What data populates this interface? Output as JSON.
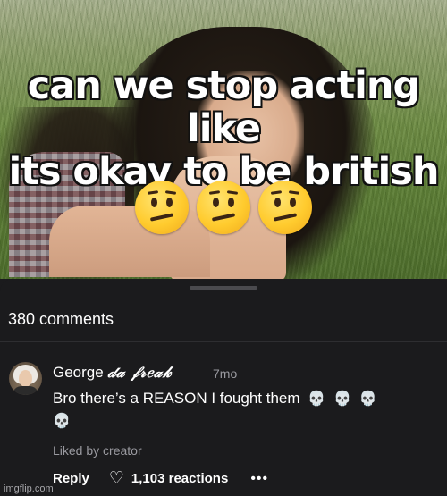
{
  "meme": {
    "caption_lines": [
      "can we stop acting like",
      "its okay to be british"
    ],
    "emojis": [
      "confused-face",
      "confused-face",
      "confused-face"
    ]
  },
  "comments": {
    "count_label": "380 comments",
    "items": [
      {
        "author": "George",
        "author_suffix": "𝒹𝒶 𝒻𝓇𝑒𝒶𝓀",
        "time": "7mo",
        "text": "Bro there’s a REASON I fought them",
        "trailing_emojis": [
          "💀",
          "💀",
          "💀",
          "💀"
        ],
        "liked_label": "Liked by creator",
        "reply_label": "Reply",
        "reactions_label": "1,103 reactions",
        "more_label": "•••"
      }
    ]
  },
  "watermark": "imgflip.com"
}
